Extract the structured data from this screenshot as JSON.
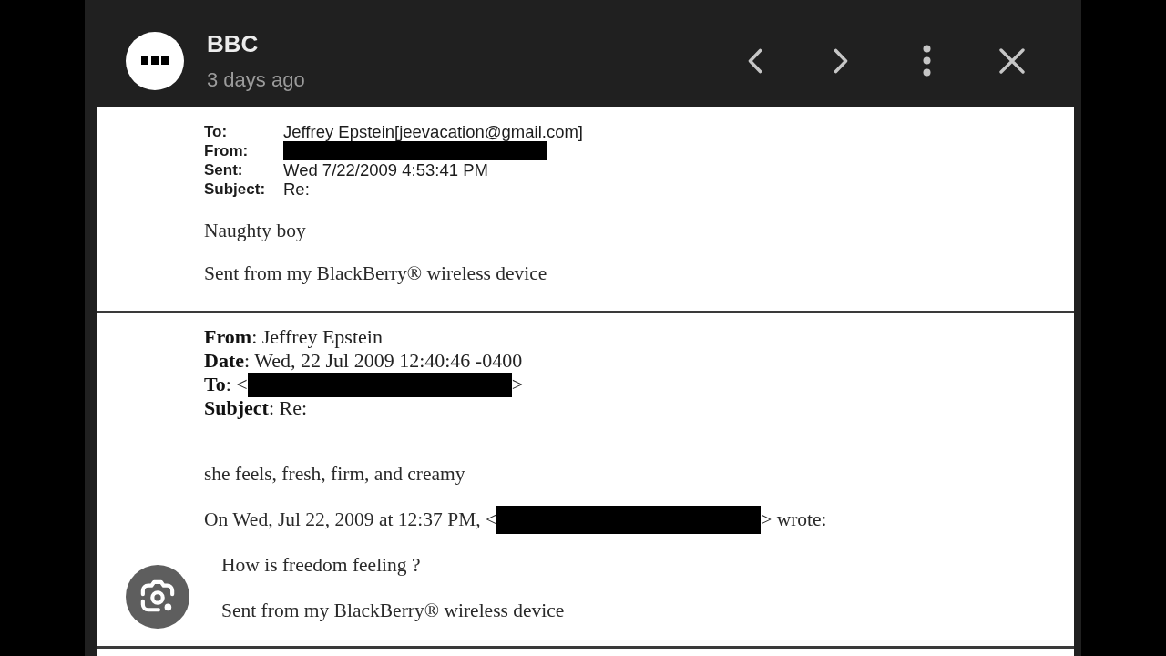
{
  "viewer": {
    "sender": "BBC",
    "time": "3 days ago"
  },
  "document": {
    "messages": [
      {
        "kind": "memo",
        "headers": [
          {
            "label": "To:",
            "parts": [
              {
                "kind": "text",
                "text": "Jeffrey Epstein[jeevacation@gmail.com]"
              }
            ]
          },
          {
            "label": "From:",
            "parts": [
              {
                "kind": "redaction"
              }
            ]
          },
          {
            "label": "Sent:",
            "parts": [
              {
                "kind": "text",
                "text": "Wed 7/22/2009 4:53:41 PM"
              }
            ]
          },
          {
            "label": "Subject:",
            "parts": [
              {
                "kind": "text",
                "text": "Re:"
              }
            ]
          }
        ],
        "body": [
          {
            "parts": [
              {
                "kind": "text",
                "text": "Naughty boy"
              }
            ]
          },
          {
            "parts": [
              {
                "kind": "text",
                "text": "Sent from my BlackBerry® wireless device"
              }
            ]
          }
        ]
      },
      {
        "kind": "reply",
        "headers": [
          {
            "parts": [
              {
                "kind": "text",
                "text": "**From**: Jeffrey Epstein"
              }
            ]
          },
          {
            "parts": [
              {
                "kind": "text",
                "text": "**Date**: Wed, 22 Jul 2009 12:40:46 -0400"
              }
            ]
          },
          {
            "parts": [
              {
                "kind": "text",
                "text": "**To**: <"
              },
              {
                "kind": "redaction"
              },
              {
                "kind": "text",
                "text": ">"
              }
            ]
          },
          {
            "parts": [
              {
                "kind": "text",
                "text": "**Subject**: Re:"
              }
            ]
          }
        ],
        "body": [
          {
            "parts": [
              {
                "kind": "text",
                "text": "she feels, fresh, firm, and creamy"
              }
            ]
          },
          {
            "parts": [
              {
                "kind": "text",
                "text": "On Wed, Jul 22, 2009 at 12:37 PM, <"
              },
              {
                "kind": "redaction"
              },
              {
                "kind": "text",
                "text": "> wrote:"
              }
            ]
          }
        ],
        "quote": [
          {
            "parts": [
              {
                "kind": "text",
                "text": "How is freedom feeling ?"
              }
            ]
          },
          {
            "parts": [
              {
                "kind": "text",
                "text": "Sent from my BlackBerry® wireless device"
              }
            ]
          }
        ]
      }
    ]
  }
}
